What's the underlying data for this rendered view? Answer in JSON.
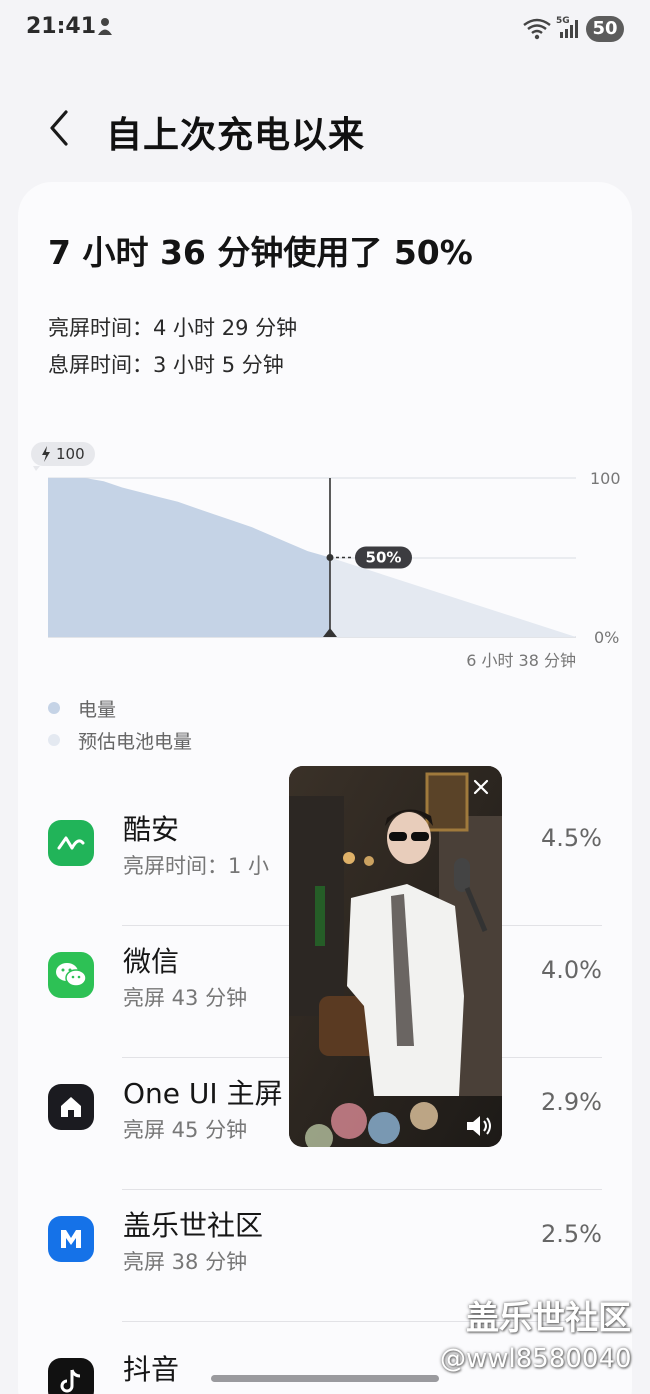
{
  "status_bar": {
    "time": "21:41",
    "network": "5G",
    "battery_level": "50",
    "icons": [
      "notification-icon",
      "wifi-icon",
      "signal-icon"
    ]
  },
  "header": {
    "title": "自上次充电以来",
    "back_icon": "chevron-left-icon"
  },
  "summary": {
    "headline": "7 小时 36 分钟使用了 50%",
    "screen_on": "亮屏时间：4 小时 29 分钟",
    "screen_off": "息屏时间：3 小时 5 分钟"
  },
  "chart_data": {
    "type": "area",
    "charge_start_label": "100",
    "y_tick_labels": [
      "100",
      "0%"
    ],
    "current_marker_label": "50%",
    "remaining_label": "6 小时 38 分钟",
    "ylim": [
      0,
      100
    ],
    "series": [
      {
        "name": "电量",
        "x_hours": [
          0,
          1,
          1.5,
          2,
          2.5,
          3,
          3.5,
          4,
          4.5,
          5,
          5.5,
          6,
          6.5,
          7,
          7.6
        ],
        "values": [
          100,
          100,
          98,
          94,
          91,
          88,
          85,
          81,
          77,
          73,
          69,
          64,
          59,
          54,
          50
        ]
      },
      {
        "name": "预估电池电量",
        "x_hours": [
          7.6,
          14.23
        ],
        "values": [
          50,
          0
        ]
      }
    ],
    "colors": {
      "actual": "#c5d3e6",
      "estimate": "#e4e9f1"
    }
  },
  "legend": [
    {
      "label": "电量",
      "color": "#c5d3e6"
    },
    {
      "label": "预估电池电量",
      "color": "#e4e9f1"
    }
  ],
  "apps": [
    {
      "name": "酷安",
      "time": "亮屏时间：1 小",
      "percent": "4.5%",
      "icon": "coolapk-icon",
      "color": "#21b459"
    },
    {
      "name": "微信",
      "time": "亮屏 43 分钟",
      "percent": "4.0%",
      "icon": "wechat-icon",
      "color": "#2dc155"
    },
    {
      "name": "One UI 主屏",
      "time": "亮屏 45 分钟",
      "percent": "2.9%",
      "icon": "home-icon",
      "color": "#1b1b20"
    },
    {
      "name": "盖乐世社区",
      "time": "亮屏 38 分钟",
      "percent": "2.5%",
      "icon": "members-icon",
      "color": "#1572e8"
    },
    {
      "name": "抖音",
      "time": "",
      "percent": "",
      "icon": "douyin-icon",
      "color": "#111111"
    }
  ],
  "video_overlay": {
    "close_icon": "close-icon",
    "volume_icon": "volume-icon"
  },
  "watermark": {
    "main": "盖乐世社区",
    "sub": "@wwl8580040"
  }
}
